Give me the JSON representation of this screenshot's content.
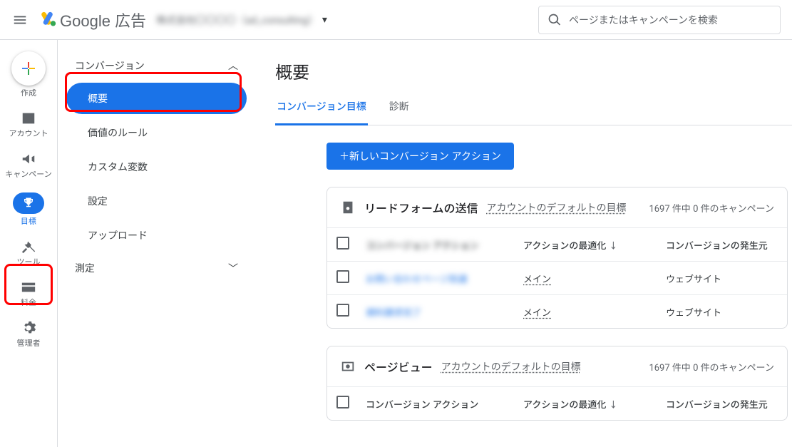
{
  "topbar": {
    "brand": "Google 広告",
    "account_blur": "株式会社〇〇〇〇（ad_consulting）",
    "search_placeholder": "ページまたはキャンペーンを検索"
  },
  "rail": {
    "create": "作成",
    "account": "アカウント",
    "campaigns": "キャンペーン",
    "goals": "目標",
    "tools": "ツール",
    "billing": "料金",
    "admin": "管理者"
  },
  "sidenav": {
    "conversion_head": "コンバージョン",
    "overview": "概要",
    "value_rules": "価値のルール",
    "custom_vars": "カスタム変数",
    "settings": "設定",
    "upload": "アップロード",
    "measure_head": "測定"
  },
  "main": {
    "title": "概要",
    "tab_goals": "コンバージョン目標",
    "tab_diag": "診断",
    "new_action": "＋新しいコンバージョン アクション",
    "cols": {
      "c1": "コンバージョン アクション",
      "c2": "アクションの最適化",
      "c3": "コンバージョンの発生元"
    },
    "group1": {
      "title": "リードフォームの送信",
      "sub": "アカウントのデフォルトの目標",
      "stats": "1697 件中 0 件のキャンペーン",
      "rows": [
        {
          "name": "お問い合わせページ到達",
          "opt": "メイン",
          "src": "ウェブサイト"
        },
        {
          "name": "資料請求完了",
          "opt": "メイン",
          "src": "ウェブサイト"
        }
      ]
    },
    "group2": {
      "title": "ページビュー",
      "sub": "アカウントのデフォルトの目標",
      "stats": "1697 件中 0 件のキャンペーン"
    }
  }
}
